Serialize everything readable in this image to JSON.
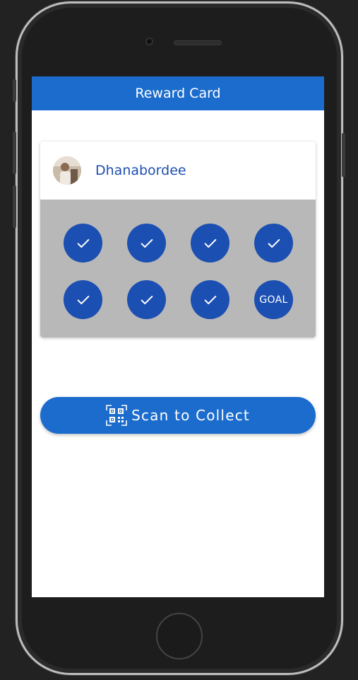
{
  "app_bar": {
    "title": "Reward Card"
  },
  "user": {
    "name": "Dhanabordee"
  },
  "stamps": [
    {
      "state": "collected",
      "icon": "check-icon"
    },
    {
      "state": "collected",
      "icon": "check-icon"
    },
    {
      "state": "collected",
      "icon": "check-icon"
    },
    {
      "state": "collected",
      "icon": "check-icon"
    },
    {
      "state": "collected",
      "icon": "check-icon"
    },
    {
      "state": "collected",
      "icon": "check-icon"
    },
    {
      "state": "collected",
      "icon": "check-icon"
    },
    {
      "state": "goal",
      "label": "GOAL"
    }
  ],
  "scan_button": {
    "label": "Scan to Collect",
    "icon": "qr-code-icon"
  },
  "colors": {
    "app_bar": "#1b6ccc",
    "stamp": "#1c4fb2",
    "stamp_area": "#b8b8b8",
    "user_name": "#1d4fb0",
    "scan_button": "#1b6ccc"
  }
}
